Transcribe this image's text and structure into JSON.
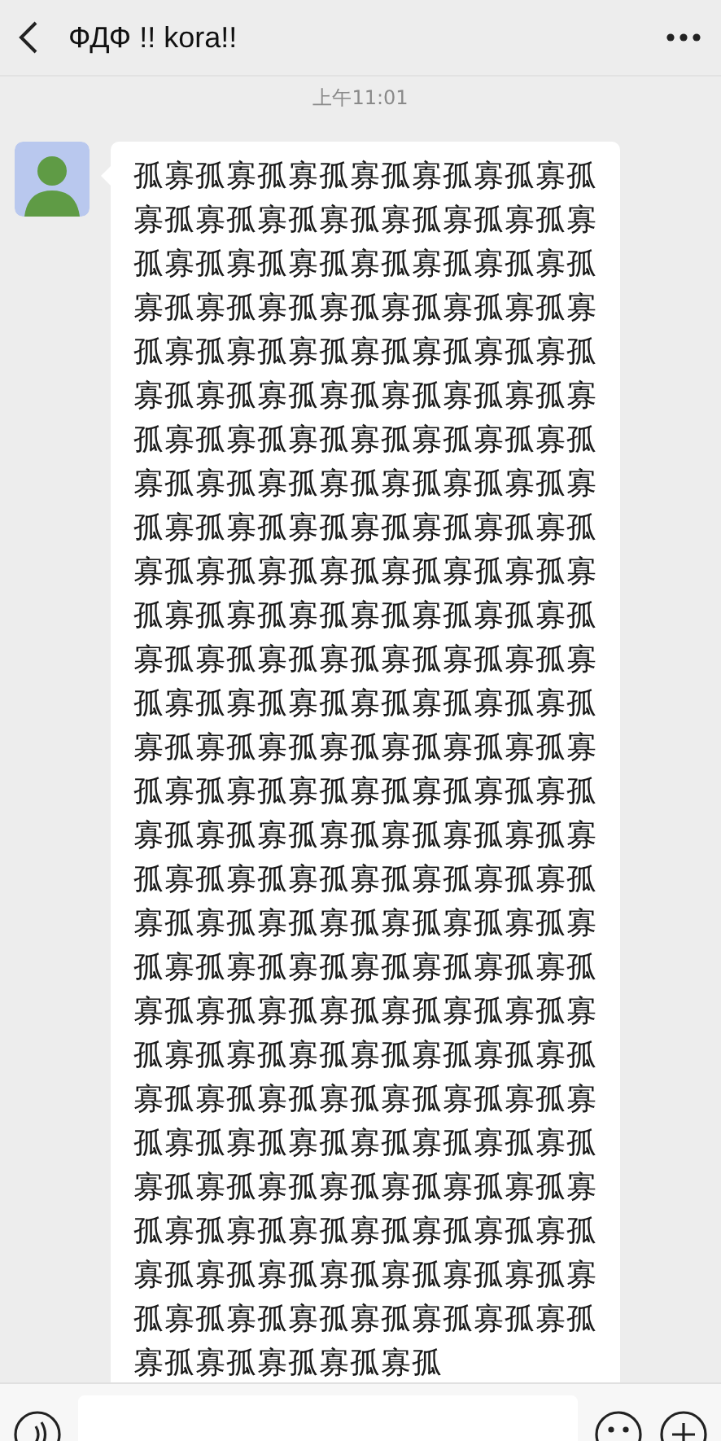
{
  "header": {
    "title": "ФДФ !! kora!!"
  },
  "timestamp": "上午11:01",
  "messages": [
    {
      "kind": "incoming",
      "text": "孤寡孤寡孤寡孤寡孤寡孤寡孤寡孤寡孤寡孤寡孤寡孤寡孤寡孤寡孤寡孤寡孤寡孤寡孤寡孤寡孤寡孤寡孤寡孤寡孤寡孤寡孤寡孤寡孤寡孤寡孤寡孤寡孤寡孤寡孤寡孤寡孤寡孤寡孤寡孤寡孤寡孤寡孤寡孤寡孤寡孤寡孤寡孤寡孤寡孤寡孤寡孤寡孤寡孤寡孤寡孤寡孤寡孤寡孤寡孤寡孤寡孤寡孤寡孤寡孤寡孤寡孤寡孤寡孤寡孤寡孤寡孤寡孤寡孤寡孤寡孤寡孤寡孤寡孤寡孤寡孤寡孤寡孤寡孤寡孤寡孤寡孤寡孤寡孤寡孤寡孤寡孤寡孤寡孤寡孤寡孤寡孤寡孤寡孤寡孤寡孤寡孤寡孤寡孤寡孤寡孤寡孤寡孤寡孤寡孤寡孤寡孤寡孤寡孤寡孤寡孤寡孤寡孤寡孤寡孤寡孤寡孤寡孤寡孤寡孤寡孤寡孤寡孤寡孤寡孤寡孤寡孤寡孤寡孤寡孤寡孤寡孤寡孤寡孤寡孤寡孤寡孤寡孤寡孤寡孤寡孤寡孤寡孤寡孤寡孤寡孤寡孤寡孤寡孤寡孤寡孤寡孤寡孤寡孤寡孤寡孤寡孤寡孤寡孤寡孤寡孤寡孤寡孤寡孤寡孤寡孤寡孤寡孤寡孤寡孤寡孤寡孤寡孤寡孤寡孤寡孤寡孤寡孤寡孤寡孤寡孤寡孤寡孤寡孤寡孤寡孤寡孤寡孤寡孤寡孤寡孤寡孤寡孤寡孤寡孤寡孤寡孤寡孤寡孤寡孤寡孤寡孤寡孤"
    }
  ]
}
